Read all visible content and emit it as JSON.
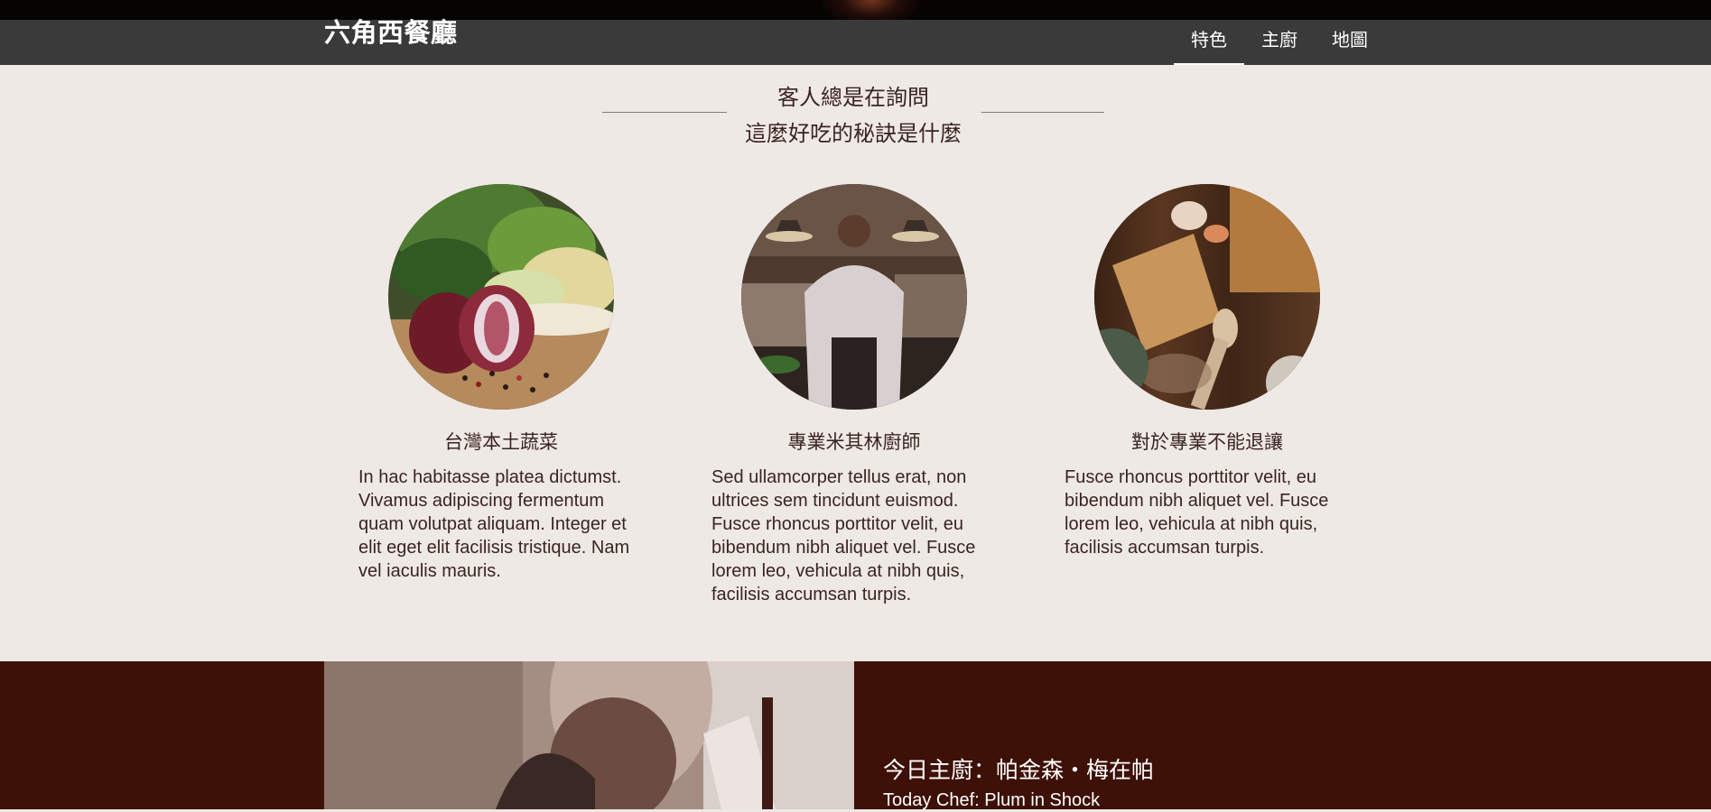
{
  "header": {
    "brand": "六角西餐廳",
    "nav": [
      {
        "label": "特色",
        "active": true
      },
      {
        "label": "主廚",
        "active": false
      },
      {
        "label": "地圖",
        "active": false
      }
    ]
  },
  "intro": {
    "line1": "客人總是在詢問",
    "line2": "這麼好吃的秘訣是什麼"
  },
  "features": [
    {
      "title": "台灣本土蔬菜",
      "text": "In hac habitasse platea dictumst. Vivamus adipiscing fermentum quam volutpat aliquam. Integer et elit eget elit facilisis tristique. Nam vel iaculis mauris."
    },
    {
      "title": "專業米其林廚師",
      "text": "Sed ullamcorper tellus erat, non ultrices sem tincidunt euismod. Fusce rhoncus porttitor velit, eu bibendum nibh aliquet vel. Fusce lorem leo, vehicula at nibh quis, facilisis accumsan turpis."
    },
    {
      "title": "對於專業不能退讓",
      "text": "Fusce rhoncus porttitor velit, eu bibendum nibh aliquet vel. Fusce lorem leo, vehicula at nibh quis, facilisis accumsan turpis."
    }
  ],
  "chef": {
    "title": "今日主廚：帕金森・梅在帕",
    "subtitle": "Today Chef: Plum in Shock"
  },
  "colors": {
    "page_bg": "#efe9e6",
    "navbar": "#3b3a3a",
    "chef_band": "#3d1108",
    "text": "#3a2420"
  }
}
